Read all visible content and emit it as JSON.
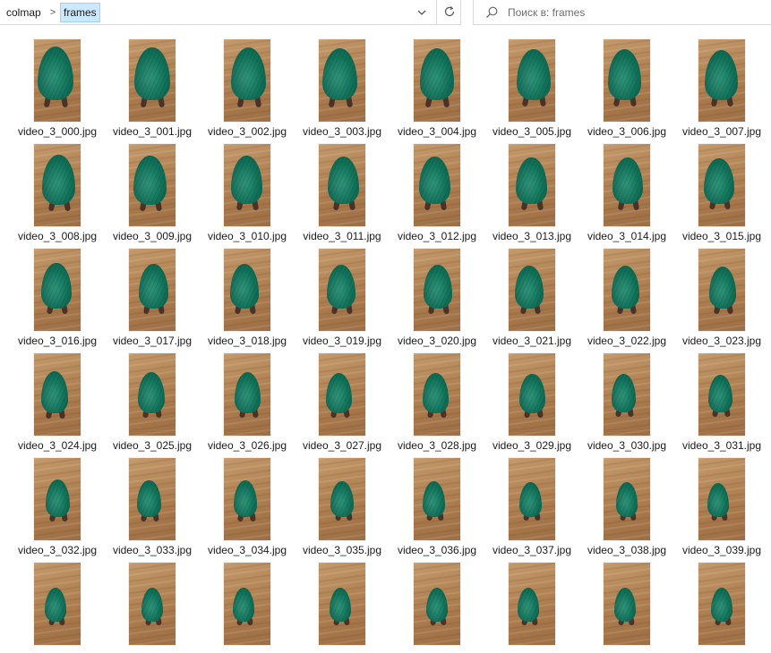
{
  "address_bar": {
    "breadcrumbs": [
      "colmap",
      "frames"
    ],
    "separator": ">",
    "dropdown_icon": "chevron-down-icon",
    "refresh_icon": "refresh-icon"
  },
  "search": {
    "placeholder": "Поиск в: frames",
    "icon": "search-icon"
  },
  "files": [
    "video_3_000.jpg",
    "video_3_001.jpg",
    "video_3_002.jpg",
    "video_3_003.jpg",
    "video_3_004.jpg",
    "video_3_005.jpg",
    "video_3_006.jpg",
    "video_3_007.jpg",
    "video_3_008.jpg",
    "video_3_009.jpg",
    "video_3_010.jpg",
    "video_3_011.jpg",
    "video_3_012.jpg",
    "video_3_013.jpg",
    "video_3_014.jpg",
    "video_3_015.jpg",
    "video_3_016.jpg",
    "video_3_017.jpg",
    "video_3_018.jpg",
    "video_3_019.jpg",
    "video_3_020.jpg",
    "video_3_021.jpg",
    "video_3_022.jpg",
    "video_3_023.jpg",
    "video_3_024.jpg",
    "video_3_025.jpg",
    "video_3_026.jpg",
    "video_3_027.jpg",
    "video_3_028.jpg",
    "video_3_029.jpg",
    "video_3_030.jpg",
    "video_3_031.jpg",
    "video_3_032.jpg",
    "video_3_033.jpg",
    "video_3_034.jpg",
    "video_3_035.jpg",
    "video_3_036.jpg",
    "video_3_037.jpg",
    "video_3_038.jpg",
    "video_3_039.jpg"
  ],
  "colors": {
    "selection_bg": "#cce8ff",
    "selection_border": "#99d1ff",
    "floor": "#b38556",
    "plush": "#107058"
  }
}
